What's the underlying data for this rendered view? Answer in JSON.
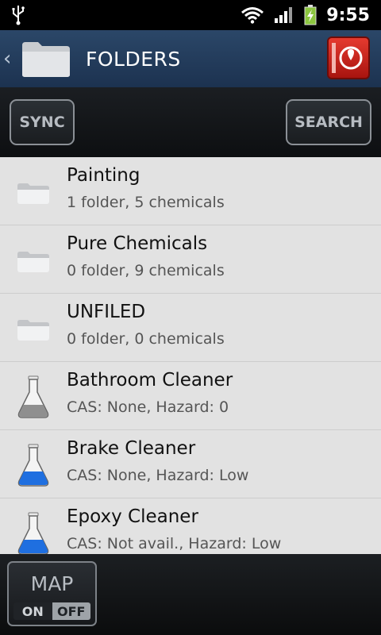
{
  "status_bar": {
    "time": "9:55",
    "icons": [
      "usb-icon",
      "wifi-icon",
      "signal-icon",
      "battery-charging-icon"
    ],
    "battery_color": "#8cc63f"
  },
  "header": {
    "title": "FOLDERS",
    "back_icon": "chevron-left-icon",
    "folder_icon": "folder-icon",
    "logo_icon": "app-logo-icon",
    "bar_color": "#1f3655"
  },
  "toolbar": {
    "sync_label": "SYNC",
    "search_label": "SEARCH"
  },
  "list": {
    "items": [
      {
        "type": "folder",
        "icon": "folder-icon",
        "title": "Painting",
        "subtitle": "1 folder, 5 chemicals"
      },
      {
        "type": "folder",
        "icon": "folder-icon",
        "title": "Pure Chemicals",
        "subtitle": "0 folder, 9 chemicals"
      },
      {
        "type": "folder",
        "icon": "folder-icon",
        "title": "UNFILED",
        "subtitle": "0 folder, 0 chemicals"
      },
      {
        "type": "chemical",
        "icon": "flask-icon",
        "liquid_color": "#8f8f8f",
        "title": "Bathroom Cleaner",
        "subtitle": "CAS: None, Hazard: 0"
      },
      {
        "type": "chemical",
        "icon": "flask-icon",
        "liquid_color": "#1f6fe0",
        "title": "Brake Cleaner",
        "subtitle": "CAS: None, Hazard: Low"
      },
      {
        "type": "chemical",
        "icon": "flask-icon",
        "liquid_color": "#1f6fe0",
        "title": "Epoxy Cleaner",
        "subtitle": "CAS: Not avail., Hazard: Low"
      }
    ]
  },
  "bottom_bar": {
    "map_label": "MAP",
    "on_label": "ON",
    "off_label": "OFF",
    "map_state": "OFF"
  }
}
